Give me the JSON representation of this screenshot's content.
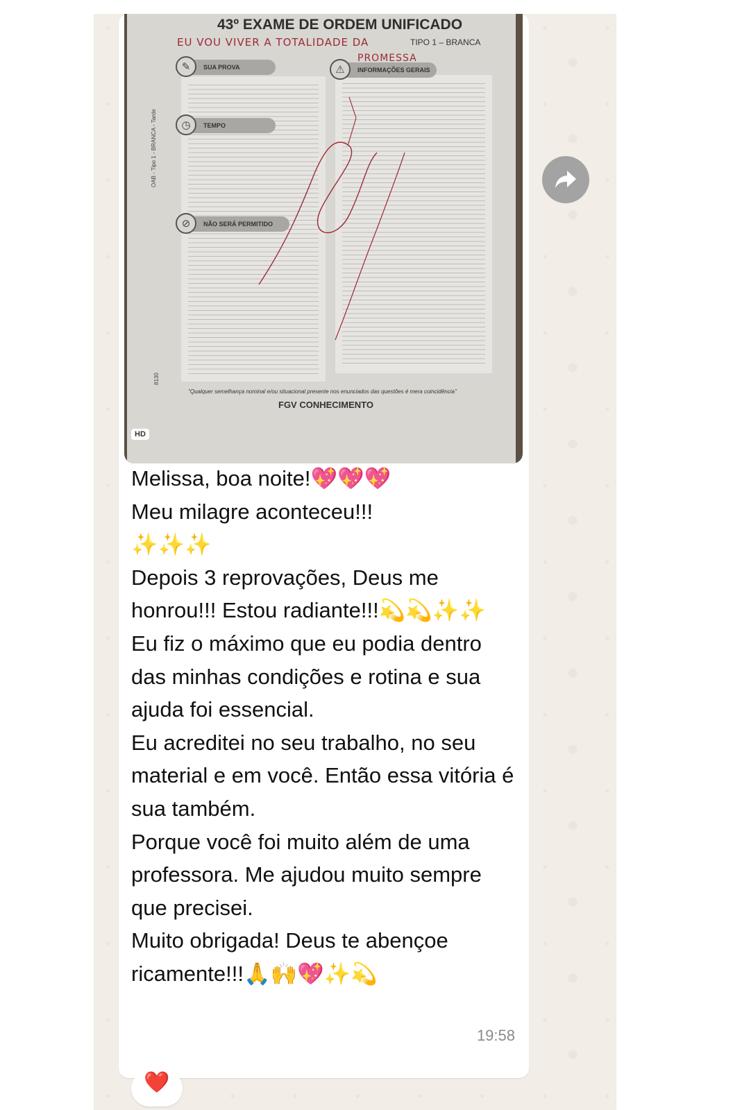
{
  "photo": {
    "title": "43º EXAME DE ORDEM UNIFICADO",
    "tipo": "TIPO 1 – BRANCA",
    "handwriting_line1": "EU VOU VIVER A TOTALIDADE DA",
    "handwriting_line2": "PROMESSA",
    "sections": {
      "sua_prova": "SUA PROVA",
      "tempo": "TEMPO",
      "nao_sera_permitido": "NÃO SERÁ PERMITIDO",
      "informacoes_gerais": "INFORMAÇÕES GERAIS"
    },
    "side_code": "OAB - Tipo 1 - BRANCA - Tarde",
    "side_number": "8130",
    "footer_quote": "\"Qualquer semelhança nominal e/ou situacional presente nos enunciados das questões é mera coincidência\"",
    "footer_brand": "FGV CONHECIMENTO",
    "hd_badge": "HD"
  },
  "message": {
    "lines": [
      "Melissa, boa noite!💖💖💖",
      "Meu milagre aconteceu!!!",
      "✨✨✨",
      "Depois 3 reprovações, Deus me honrou!!! Estou radiante!!!💫💫✨✨",
      "Eu fiz o máximo que eu podia dentro das minhas condições e rotina e sua ajuda foi essencial.",
      "Eu acreditei no seu trabalho, no seu material e em você. Então essa vitória é sua também.",
      "Porque você foi muito além de uma professora. Me ajudou muito sempre que precisei.",
      "Muito obrigada! Deus te abençoe ricamente!!!🙏🙌💖✨💫"
    ],
    "time": "19:58"
  },
  "reaction": "❤️",
  "icons": {
    "forward": "forward-arrow-icon"
  },
  "colors": {
    "chat_background": "#f2ede6",
    "bubble": "#ffffff",
    "handwriting_ink": "#9b2a38",
    "forward_button": "#a3a3a3",
    "timestamp": "#8a8a8a"
  }
}
